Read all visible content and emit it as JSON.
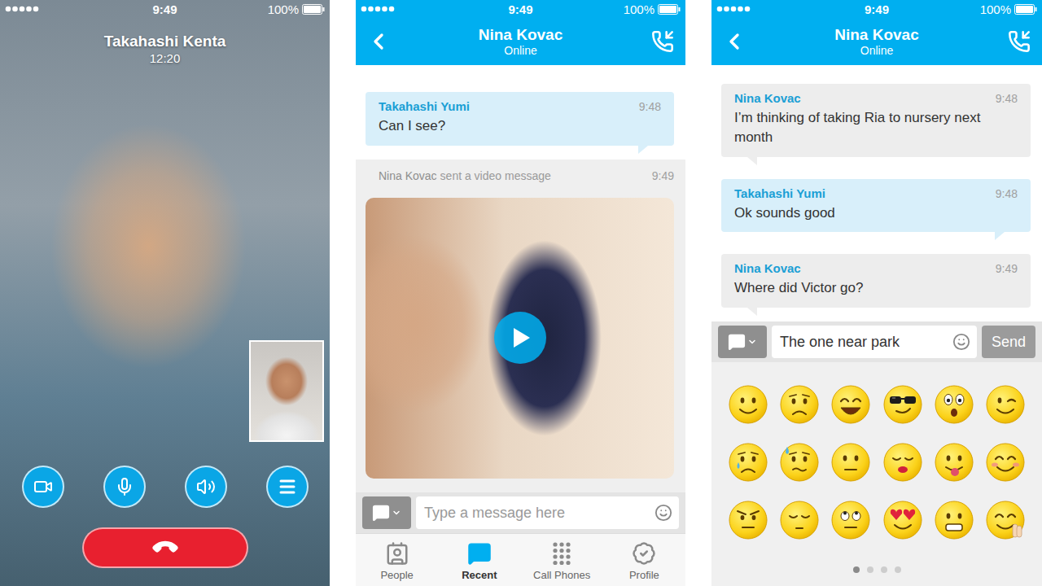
{
  "call_screen": {
    "status_bar": {
      "time": "9:49",
      "battery": "100%"
    },
    "caller": {
      "name": "Takahashi Kenta",
      "duration": "12:20"
    }
  },
  "video_chat_screen": {
    "status_bar": {
      "time": "9:49",
      "battery": "100%"
    },
    "header": {
      "name": "Nina Kovac",
      "status": "Online"
    },
    "messages": [
      {
        "kind": "text",
        "sender": "Takahashi Yumi",
        "time": "9:48",
        "text": "Can I see?",
        "outgoing": true
      },
      {
        "kind": "video",
        "sender": "Nina Kovac",
        "caption": "sent a video message",
        "time": "9:49",
        "outgoing": false
      }
    ],
    "composer": {
      "placeholder": "Type a message here",
      "value": ""
    },
    "tabs": [
      {
        "label": "People",
        "selected": false
      },
      {
        "label": "Recent",
        "selected": true
      },
      {
        "label": "Call Phones",
        "selected": false
      },
      {
        "label": "Profile",
        "selected": false
      }
    ]
  },
  "emoji_chat_screen": {
    "status_bar": {
      "time": "9:49",
      "battery": "100%"
    },
    "header": {
      "name": "Nina Kovac",
      "status": "Online"
    },
    "messages": [
      {
        "kind": "text",
        "sender": "Nina Kovac",
        "time": "9:48",
        "text": "I’m thinking of taking Ria to nursery next month",
        "outgoing": false
      },
      {
        "kind": "text",
        "sender": "Takahashi Yumi",
        "time": "9:48",
        "text": "Ok sounds good",
        "outgoing": true
      },
      {
        "kind": "text",
        "sender": "Nina Kovac",
        "time": "9:49",
        "text": "Where did Victor go?",
        "outgoing": false
      }
    ],
    "composer": {
      "placeholder": "",
      "value": "The one near park",
      "send": "Send"
    },
    "emoji_pages": [
      {
        "selected": true
      },
      {
        "selected": false
      },
      {
        "selected": false
      },
      {
        "selected": false
      }
    ]
  }
}
